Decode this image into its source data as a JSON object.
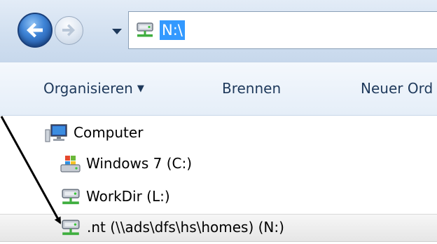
{
  "address_bar": {
    "path": "N:\\",
    "back_icon": "back-arrow-icon",
    "forward_icon": "forward-arrow-icon",
    "history_icon": "chevron-down-icon",
    "location_icon": "network-drive-icon"
  },
  "toolbar": {
    "organize_label": "Organisieren",
    "organize_caret": "▼",
    "burn_label": "Brennen",
    "new_folder_label": "Neuer Ord"
  },
  "tree": {
    "computer": {
      "label": "Computer",
      "icon": "computer-icon"
    },
    "drives": [
      {
        "label": "Windows 7 (C:)",
        "icon": "windows-drive-icon"
      },
      {
        "label": "WorkDir (L:)",
        "icon": "network-drive-icon"
      },
      {
        "label": ".nt (\\\\ads\\dfs\\hs\\homes) (N:)",
        "icon": "network-drive-icon",
        "selected": true
      }
    ]
  },
  "colors": {
    "selection_blue": "#3399ff",
    "toolbar_text": "#1e395b",
    "pointer_arrow": "#000000"
  }
}
